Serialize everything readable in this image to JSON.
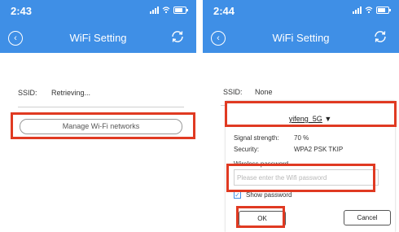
{
  "left": {
    "time": "2:43",
    "title": "WiFi Setting",
    "ssid_label": "SSID:",
    "ssid_value": "Retrieving...",
    "manage_button": "Manage Wi-Fi networks"
  },
  "right": {
    "time": "2:44",
    "title": "WiFi Setting",
    "ssid_label": "SSID:",
    "ssid_value": "None",
    "dialog": {
      "network_name": "yifeng_5G",
      "dropdown_arrow": "▼",
      "signal_label": "Signal strength:",
      "signal_value": "70 %",
      "security_label": "Security:",
      "security_value": "WPA2 PSK TKIP",
      "password_label": "Wireless password",
      "password_placeholder": "Please enter the Wifi password",
      "show_password_label": "Show password",
      "show_password_checked": true,
      "ok_label": "OK",
      "cancel_label": "Cancel"
    }
  },
  "colors": {
    "header": "#3f8fe6",
    "highlight": "#e03a22"
  },
  "icons": [
    "back-arrow-icon",
    "refresh-icon",
    "signal-bars-icon",
    "wifi-icon",
    "battery-icon",
    "checkbox-check-icon",
    "dropdown-arrow-icon"
  ]
}
